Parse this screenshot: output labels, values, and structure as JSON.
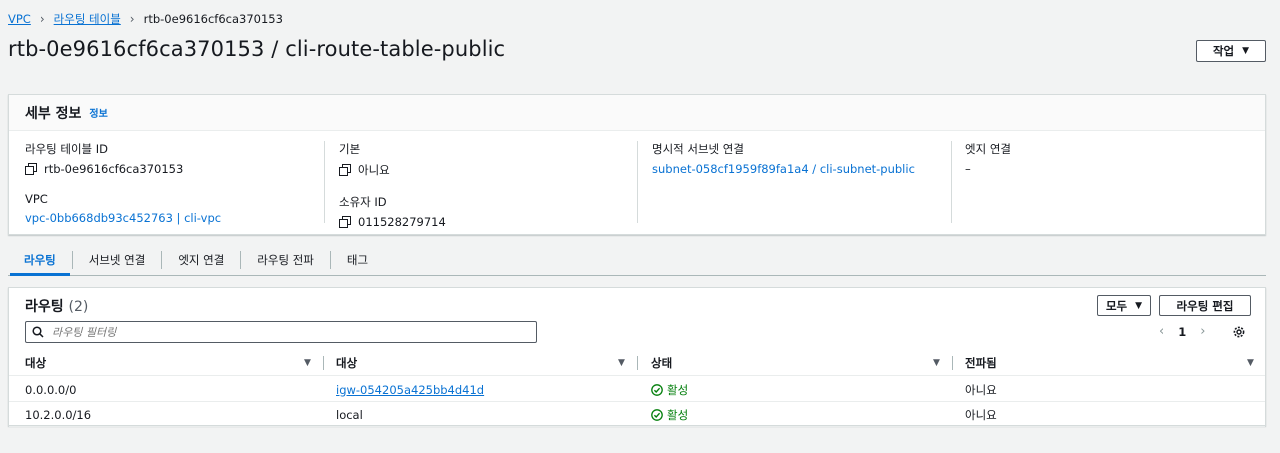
{
  "breadcrumb": {
    "items": [
      "VPC",
      "라우팅 테이블"
    ],
    "current": "rtb-0e9616cf6ca370153"
  },
  "page": {
    "title": "rtb-0e9616cf6ca370153 / cli-route-table-public",
    "actions_label": "작업"
  },
  "details": {
    "title": "세부 정보",
    "info": "정보",
    "fields": {
      "route_table_id_label": "라우팅 테이블 ID",
      "route_table_id": "rtb-0e9616cf6ca370153",
      "vpc_label": "VPC",
      "vpc": "vpc-0bb668db93c452763 | cli-vpc",
      "main_label": "기본",
      "main": "아니요",
      "owner_label": "소유자 ID",
      "owner": "011528279714",
      "explicit_subnet_label": "명시적 서브넷 연결",
      "explicit_subnet": "subnet-058cf1959f89fa1a4 / cli-subnet-public",
      "edge_label": "엣지 연결",
      "edge": "–"
    }
  },
  "tabs": [
    "라우팅",
    "서브넷 연결",
    "엣지 연결",
    "라우팅 전파",
    "태그"
  ],
  "routes": {
    "title": "라우팅",
    "count": "(2)",
    "filter_label": "모두",
    "edit_label": "라우팅 편집",
    "search_placeholder": "라우팅 필터링",
    "page": "1",
    "columns": [
      "대상",
      "대상",
      "상태",
      "전파됨"
    ],
    "rows": [
      {
        "destination": "0.0.0.0/0",
        "target": "igw-054205a425bb4d41d",
        "status": "활성",
        "propagated": "아니요"
      },
      {
        "destination": "10.2.0.0/16",
        "target": "local",
        "status": "활성",
        "propagated": "아니요"
      }
    ]
  },
  "colors": {
    "link": "#0972d3",
    "success": "#037f0c",
    "border": "#d5dbdb"
  }
}
